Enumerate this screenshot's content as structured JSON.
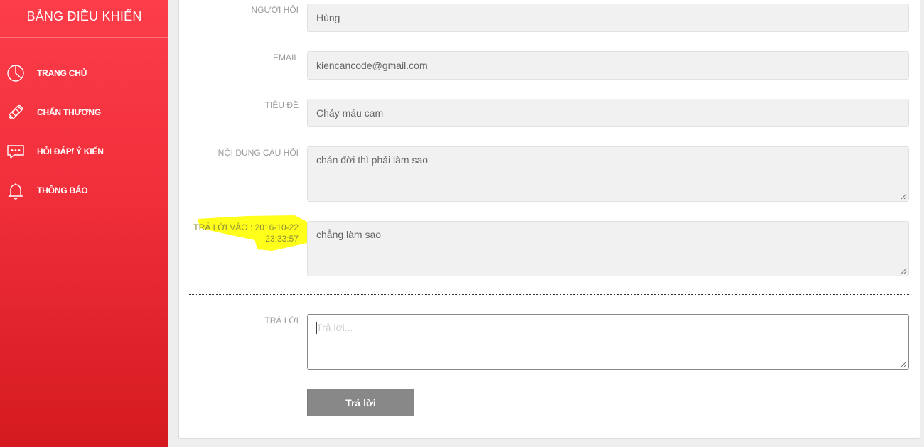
{
  "sidebar": {
    "title": "BẢNG ĐIỀU KHIỂN",
    "items": [
      {
        "label": "TRANG CHỦ",
        "icon": "pie-chart-icon"
      },
      {
        "label": "CHẤN THƯƠNG",
        "icon": "bandage-icon"
      },
      {
        "label": "HỎI ĐÁP/ Ý KIẾN",
        "icon": "chat-bubble-icon"
      },
      {
        "label": "THÔNG BÁO",
        "icon": "bell-icon"
      }
    ]
  },
  "form": {
    "asker": {
      "label": "NGƯỜI HỎI",
      "value": "Hùng"
    },
    "email": {
      "label": "EMAIL",
      "value": "kiencancode@gmail.com"
    },
    "subject": {
      "label": "TIÊU ĐỀ",
      "value": "Chảy máu cam"
    },
    "question": {
      "label": "NỘI DUNG CÂU HỎI",
      "value": "chán đời thì phải làm sao"
    },
    "answered": {
      "label_line1": "TRẢ LỜI VÀO : 2016-10-22",
      "label_line2": "23:33:57",
      "value": "chẳng làm sao"
    },
    "reply": {
      "label": "TRẢ LỜI",
      "placeholder": "Trả lời...",
      "value": ""
    },
    "submit_label": "Trả lời"
  },
  "colors": {
    "sidebar_top": "#fc3d4a",
    "sidebar_bottom": "#d41a1f",
    "highlight": "#ffff1a",
    "button": "#888888"
  }
}
